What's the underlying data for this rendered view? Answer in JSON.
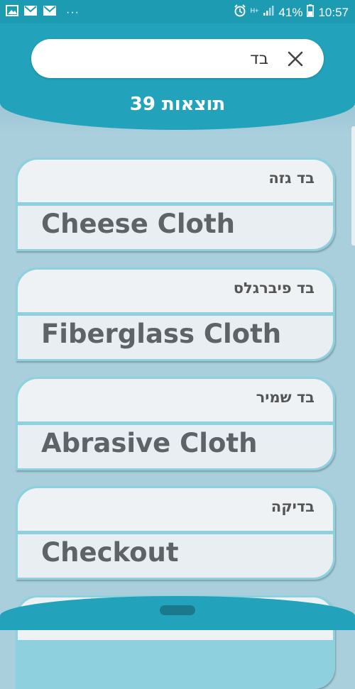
{
  "status_bar": {
    "notification_icons": [
      "gallery-icon",
      "mail-icon",
      "mail-icon"
    ],
    "more": "···",
    "network": "H+",
    "battery_percent": "41%",
    "time": "10:57"
  },
  "search": {
    "value": "בד",
    "clear_icon": "close-icon"
  },
  "results": {
    "count_label": "39 תוצאות"
  },
  "items": [
    {
      "hebrew": "בד גזה",
      "english": "Cheese Cloth"
    },
    {
      "hebrew": "בד פיברגלס",
      "english": "Fiberglass Cloth"
    },
    {
      "hebrew": "בד שמיר",
      "english": "Abrasive Cloth"
    },
    {
      "hebrew": "בדיקה",
      "english": "Checkout"
    }
  ],
  "colors": {
    "primary": "#23a3bb",
    "status_bar": "#1d9bb3",
    "background": "#a9cfdd",
    "card": "#e8eef1",
    "card_border": "#8fd0df"
  }
}
